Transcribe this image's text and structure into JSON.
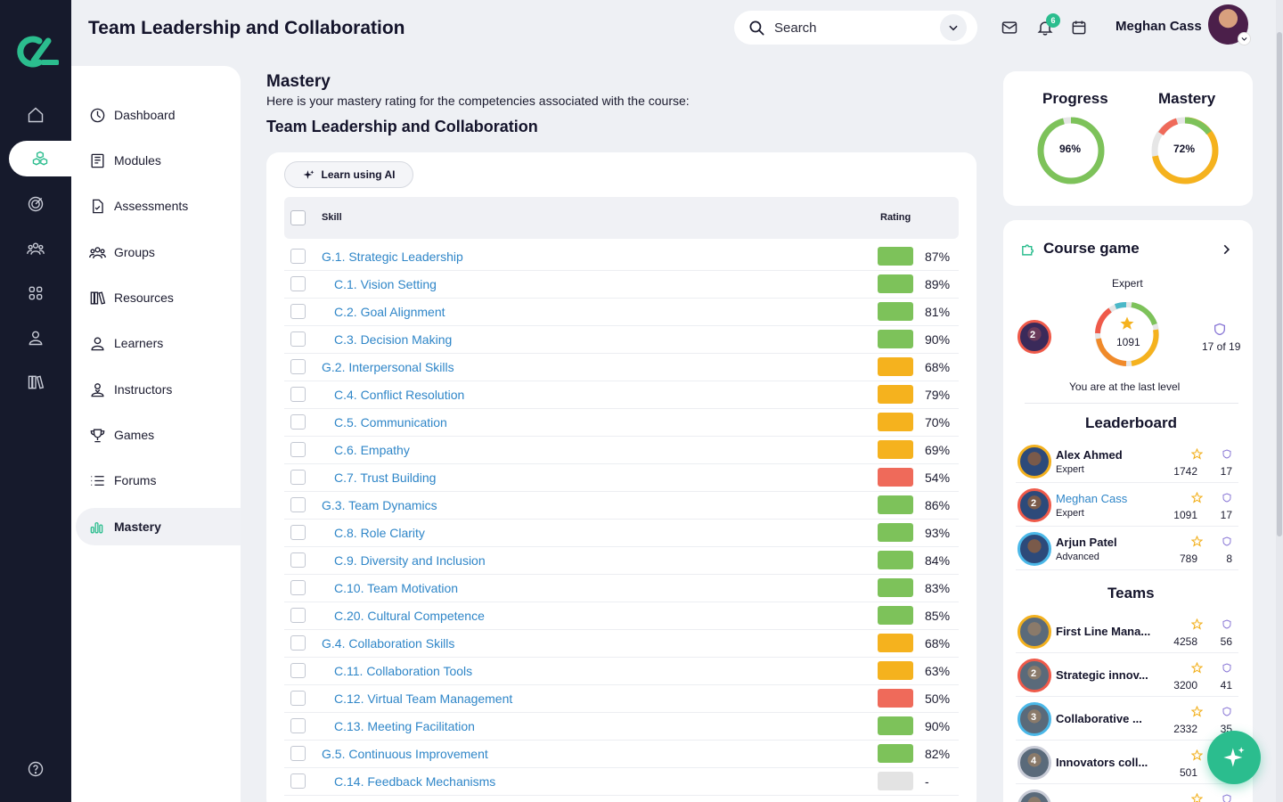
{
  "header": {
    "title": "Team Leadership and Collaboration",
    "search_placeholder": "Search",
    "notifications_count": "6",
    "user_name": "Meghan Cass"
  },
  "rail": {
    "icons": [
      "home-icon",
      "modules-icon",
      "target-icon",
      "users-icon",
      "grid-icon",
      "person-icon",
      "library-icon",
      "help-icon"
    ]
  },
  "sidebar": {
    "items": [
      {
        "label": "Dashboard",
        "icon": "dashboard-icon"
      },
      {
        "label": "Modules",
        "icon": "modules-icon"
      },
      {
        "label": "Assessments",
        "icon": "assessments-icon"
      },
      {
        "label": "Groups",
        "icon": "groups-icon"
      },
      {
        "label": "Resources",
        "icon": "resources-icon"
      },
      {
        "label": "Learners",
        "icon": "learner-icon"
      },
      {
        "label": "Instructors",
        "icon": "instructor-icon"
      },
      {
        "label": "Games",
        "icon": "trophy-icon"
      },
      {
        "label": "Forums",
        "icon": "forums-icon"
      },
      {
        "label": "Mastery",
        "icon": "mastery-icon",
        "active": true
      }
    ]
  },
  "main": {
    "title": "Mastery",
    "description": "Here is your mastery rating for the competencies associated with the course:",
    "course": "Team Leadership and Collaboration",
    "ai_button": "Learn using AI",
    "columns": {
      "skill": "Skill",
      "rating": "Rating"
    },
    "skills": [
      {
        "label": "G.1. Strategic Leadership",
        "rating": "87%",
        "level": "high",
        "indent": 0
      },
      {
        "label": "C.1. Vision Setting",
        "rating": "89%",
        "level": "high",
        "indent": 1
      },
      {
        "label": "C.2. Goal Alignment",
        "rating": "81%",
        "level": "high",
        "indent": 1
      },
      {
        "label": "C.3. Decision Making",
        "rating": "90%",
        "level": "high",
        "indent": 1
      },
      {
        "label": "G.2. Interpersonal Skills",
        "rating": "68%",
        "level": "mid",
        "indent": 0
      },
      {
        "label": "C.4. Conflict Resolution",
        "rating": "79%",
        "level": "mid",
        "indent": 1
      },
      {
        "label": "C.5. Communication",
        "rating": "70%",
        "level": "mid",
        "indent": 1
      },
      {
        "label": "C.6. Empathy",
        "rating": "69%",
        "level": "mid",
        "indent": 1
      },
      {
        "label": "C.7. Trust Building",
        "rating": "54%",
        "level": "low",
        "indent": 1
      },
      {
        "label": "G.3. Team Dynamics",
        "rating": "86%",
        "level": "high",
        "indent": 0
      },
      {
        "label": "C.8. Role Clarity",
        "rating": "93%",
        "level": "high",
        "indent": 1
      },
      {
        "label": "C.9. Diversity and Inclusion",
        "rating": "84%",
        "level": "high",
        "indent": 1
      },
      {
        "label": "C.10. Team Motivation",
        "rating": "83%",
        "level": "high",
        "indent": 1
      },
      {
        "label": "C.20. Cultural Competence",
        "rating": "85%",
        "level": "high",
        "indent": 1
      },
      {
        "label": "G.4. Collaboration Skills",
        "rating": "68%",
        "level": "mid",
        "indent": 0
      },
      {
        "label": "C.11. Collaboration Tools",
        "rating": "63%",
        "level": "mid",
        "indent": 1
      },
      {
        "label": "C.12. Virtual Team Management",
        "rating": "50%",
        "level": "low",
        "indent": 1
      },
      {
        "label": "C.13. Meeting Facilitation",
        "rating": "90%",
        "level": "high",
        "indent": 1
      },
      {
        "label": "G.5. Continuous Improvement",
        "rating": "82%",
        "level": "high",
        "indent": 0
      },
      {
        "label": "C.14. Feedback Mechanisms",
        "rating": "-",
        "level": "none",
        "indent": 1
      }
    ]
  },
  "colors": {
    "high": "#7dc25a",
    "mid": "#f5b21e",
    "low": "#ef6a5a",
    "none": "#e3e3e3",
    "accent": "#2bbd8e",
    "link": "#2f86c8",
    "rail": "#161a2c"
  },
  "progress": {
    "progress_label": "Progress",
    "progress_value": "96%",
    "progress_fraction": 0.96,
    "mastery_label": "Mastery",
    "mastery_value": "72%",
    "mastery_fraction": 0.72
  },
  "game": {
    "title": "Course game",
    "level": "Expert",
    "points": "1091",
    "badges": "17 of 19",
    "status": "You are at the last level",
    "player_rank": "2"
  },
  "leaderboard": {
    "title": "Leaderboard",
    "entries": [
      {
        "name": "Alex Ahmed",
        "level": "Expert",
        "points": "1742",
        "badges": "17",
        "is_me": false
      },
      {
        "name": "Meghan Cass",
        "level": "Expert",
        "points": "1091",
        "badges": "17",
        "is_me": true,
        "rank": "2"
      },
      {
        "name": "Arjun Patel",
        "level": "Advanced",
        "points": "789",
        "badges": "8",
        "is_me": false
      }
    ]
  },
  "teams": {
    "title": "Teams",
    "entries": [
      {
        "name": "First Line Mana...",
        "points": "4258",
        "badges": "56"
      },
      {
        "name": "Strategic innov...",
        "points": "3200",
        "badges": "41",
        "rank": "2"
      },
      {
        "name": "Collaborative ...",
        "points": "2332",
        "badges": "35",
        "rank": "3"
      },
      {
        "name": "Innovators coll...",
        "points": "501",
        "badges": "",
        "rank": "4"
      },
      {
        "name": "",
        "points": "",
        "badges": ""
      }
    ]
  }
}
